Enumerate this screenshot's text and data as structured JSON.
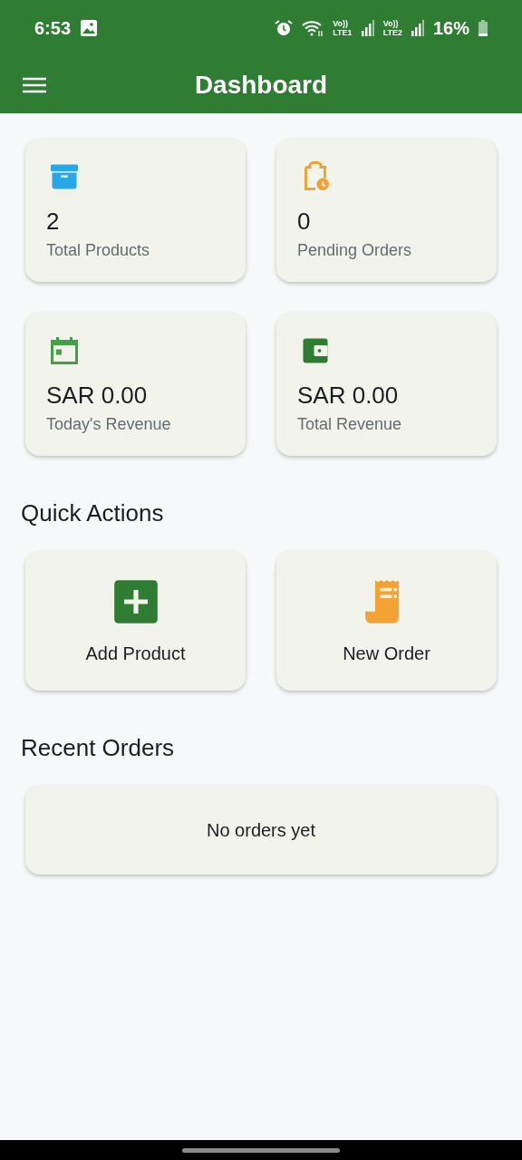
{
  "status_bar": {
    "time": "6:53",
    "sim_1": {
      "top": "Vo))",
      "bottom": "LTE1"
    },
    "sim_2": {
      "top": "Vo))",
      "bottom": "LTE2"
    },
    "battery": "16%"
  },
  "app_bar": {
    "title": "Dashboard"
  },
  "stats": [
    {
      "kind": "box",
      "color": "#29a8e8",
      "value": "2",
      "label": "Total Products"
    },
    {
      "kind": "clipboard",
      "color": "#f4a233",
      "value": "0",
      "label": "Pending Orders"
    },
    {
      "kind": "calendar",
      "color": "#43a047",
      "value": "SAR 0.00",
      "label": "Today's Revenue"
    },
    {
      "kind": "wallet",
      "color": "#2e7d32",
      "value": "SAR 0.00",
      "label": "Total Revenue"
    }
  ],
  "quick_actions": {
    "title": "Quick Actions",
    "items": [
      {
        "kind": "add",
        "color": "#2e7d32",
        "label": "Add Product"
      },
      {
        "kind": "receipt",
        "color": "#f4a233",
        "label": "New Order"
      }
    ]
  },
  "recent_orders": {
    "title": "Recent Orders",
    "empty_text": "No orders yet"
  }
}
